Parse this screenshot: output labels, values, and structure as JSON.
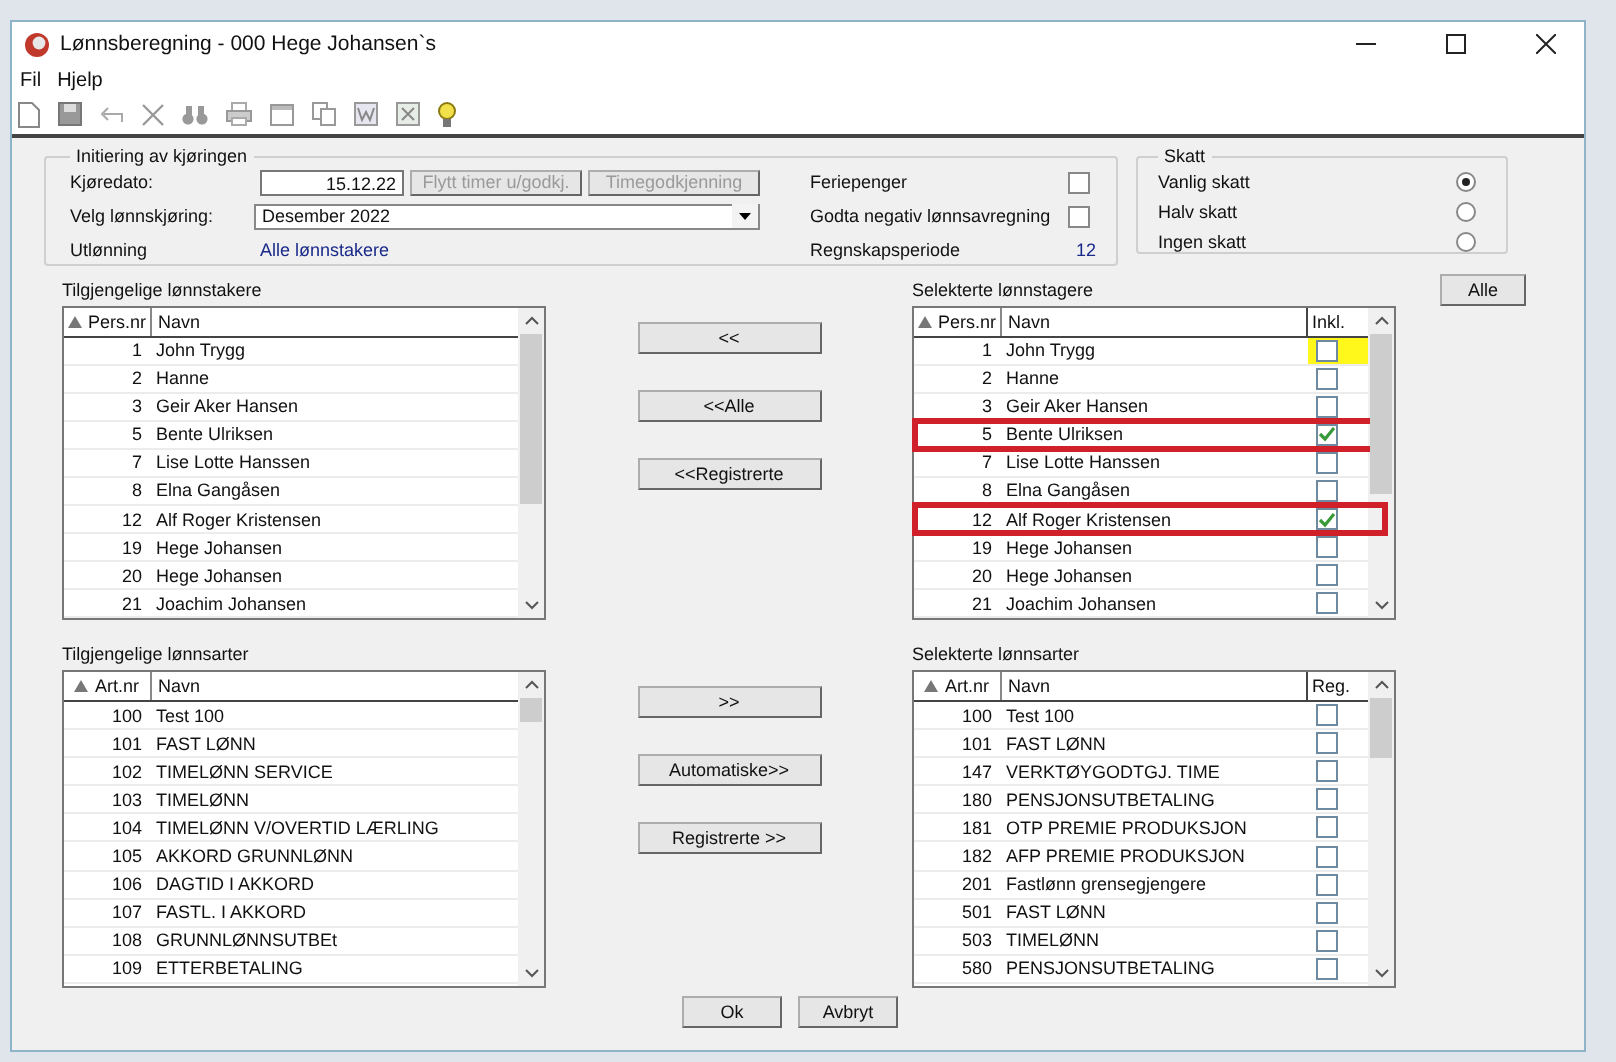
{
  "window": {
    "title": "Lønnsberegning - 000 Hege Johansen`s"
  },
  "menu": [
    {
      "label": "Fil"
    },
    {
      "label": "Hjelp"
    }
  ],
  "run_setup": {
    "title": "Initiering av kjøringen",
    "run_date_label": "Kjøredato:",
    "run_date": "15.12.22",
    "buttons": [
      {
        "label": "Flytt timer u/godkj.",
        "disabled": true
      },
      {
        "label": "Timegodkjenning",
        "disabled": true
      }
    ],
    "run_label": "Velg lønnskjøring:",
    "run_value": "Desember 2022",
    "payout_label": "Utlønning",
    "payout_value": "Alle lønnstakere",
    "options": [
      {
        "label": "Feriepenger",
        "checked": false
      },
      {
        "label": "Godta negativ lønnsavregning",
        "checked": false
      }
    ],
    "period_label": "Regnskapsperiode",
    "period": "12"
  },
  "tax": {
    "title": "Skatt",
    "options": [
      {
        "label": "Vanlig skatt",
        "selected": true
      },
      {
        "label": "Halv skatt",
        "selected": false
      },
      {
        "label": "Ingen skatt",
        "selected": false
      }
    ]
  },
  "all_button": "Alle",
  "available_employees": {
    "label": "Tilgjengelige lønnstakere",
    "columns": [
      "Pers.nr",
      "Navn"
    ],
    "rows": [
      {
        "number": "1",
        "name": "John Trygg"
      },
      {
        "number": "2",
        "name": "Hanne"
      },
      {
        "number": "3",
        "name": "Geir Aker Hansen"
      },
      {
        "number": "5",
        "name": "Bente Ulriksen"
      },
      {
        "number": "7",
        "name": "Lise Lotte Hanssen"
      },
      {
        "number": "8",
        "name": "Elna Gangåsen"
      },
      {
        "number": "12",
        "name": "Alf Roger Kristensen"
      },
      {
        "number": "19",
        "name": "Hege Johansen"
      },
      {
        "number": "20",
        "name": "Hege Johansen"
      },
      {
        "number": "21",
        "name": "Joachim Johansen"
      }
    ]
  },
  "employee_buttons": [
    "<<",
    "<<Alle",
    "<<Registrerte"
  ],
  "selected_employees": {
    "label": "Selekterte lønnstagere",
    "columns": [
      "Pers.nr",
      "Navn",
      "Inkl."
    ],
    "rows": [
      {
        "number": "1",
        "name": "John Trygg",
        "checked": false,
        "focused": true,
        "highlighted": false
      },
      {
        "number": "2",
        "name": "Hanne",
        "checked": false,
        "focused": false,
        "highlighted": false
      },
      {
        "number": "3",
        "name": "Geir Aker Hansen",
        "checked": false,
        "focused": false,
        "highlighted": false
      },
      {
        "number": "5",
        "name": "Bente Ulriksen",
        "checked": true,
        "focused": false,
        "highlighted": true
      },
      {
        "number": "7",
        "name": "Lise Lotte Hanssen",
        "checked": false,
        "focused": false,
        "highlighted": false
      },
      {
        "number": "8",
        "name": "Elna Gangåsen",
        "checked": false,
        "focused": false,
        "highlighted": false
      },
      {
        "number": "12",
        "name": "Alf Roger Kristensen",
        "checked": true,
        "focused": false,
        "highlighted": true
      },
      {
        "number": "19",
        "name": "Hege Johansen",
        "checked": false,
        "focused": false,
        "highlighted": false
      },
      {
        "number": "20",
        "name": "Hege Johansen",
        "checked": false,
        "focused": false,
        "highlighted": false
      },
      {
        "number": "21",
        "name": "Joachim Johansen",
        "checked": false,
        "focused": false,
        "highlighted": false
      }
    ]
  },
  "available_pay_types": {
    "label": "Tilgjengelige lønnsarter",
    "columns": [
      "Art.nr",
      "Navn"
    ],
    "rows": [
      {
        "number": "100",
        "name": "Test 100"
      },
      {
        "number": "101",
        "name": "FAST LØNN"
      },
      {
        "number": "102",
        "name": "TIMELØNN SERVICE"
      },
      {
        "number": "103",
        "name": "TIMELØNN"
      },
      {
        "number": "104",
        "name": "TIMELØNN V/OVERTID LÆRLING"
      },
      {
        "number": "105",
        "name": "AKKORD GRUNNLØNN"
      },
      {
        "number": "106",
        "name": "DAGTID I AKKORD"
      },
      {
        "number": "107",
        "name": "FASTL. I AKKORD"
      },
      {
        "number": "108",
        "name": "GRUNNLØNNSUTBEt"
      },
      {
        "number": "109",
        "name": "ETTERBETALING"
      }
    ]
  },
  "pay_type_buttons": [
    ">>",
    "Automatiske>>",
    "Registrerte >>"
  ],
  "selected_pay_types": {
    "label": "Selekterte lønnsarter",
    "columns": [
      "Art.nr",
      "Navn",
      "Reg."
    ],
    "rows": [
      {
        "number": "100",
        "name": "Test 100",
        "checked": false
      },
      {
        "number": "101",
        "name": "FAST LØNN",
        "checked": false
      },
      {
        "number": "147",
        "name": "VERKTØYGODTGJ. TIME",
        "checked": false
      },
      {
        "number": "180",
        "name": "PENSJONSUTBETALING",
        "checked": false
      },
      {
        "number": "181",
        "name": "OTP PREMIE PRODUKSJON",
        "checked": false
      },
      {
        "number": "182",
        "name": "AFP PREMIE PRODUKSJON",
        "checked": false
      },
      {
        "number": "201",
        "name": "Fastlønn grensegjengere",
        "checked": false
      },
      {
        "number": "501",
        "name": "FAST LØNN",
        "checked": false
      },
      {
        "number": "503",
        "name": "TIMELØNN",
        "checked": false
      },
      {
        "number": "580",
        "name": "PENSJONSUTBETALING",
        "checked": false
      }
    ]
  },
  "footer_buttons": [
    "Ok",
    "Avbryt"
  ]
}
